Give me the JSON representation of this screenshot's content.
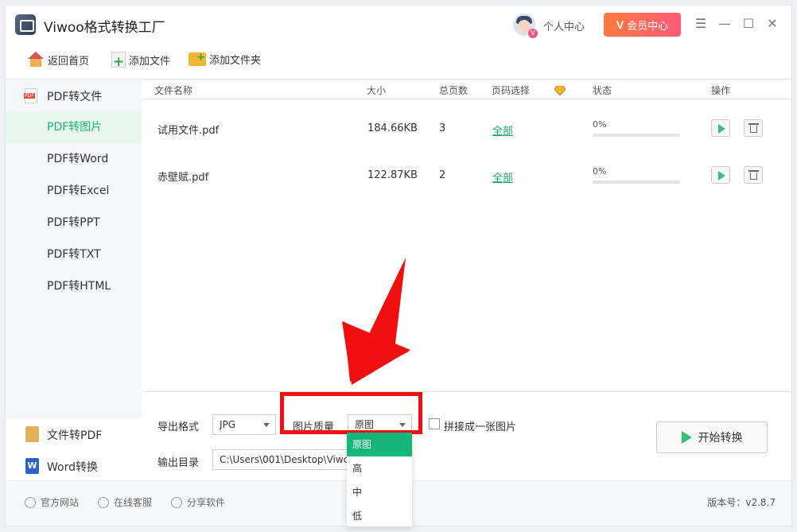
{
  "app": {
    "title": "Viwoo格式转换工厂"
  },
  "header": {
    "personal_center": "个人中心",
    "vip_center": "会员中心",
    "vip_badge": "V"
  },
  "toolbar": {
    "home": "返回首页",
    "add_file": "添加文件",
    "add_folder": "添加文件夹"
  },
  "sidebar": {
    "section_title": "PDF转文件",
    "items": [
      {
        "label": "PDF转图片",
        "active": true
      },
      {
        "label": "PDF转Word",
        "active": false
      },
      {
        "label": "PDF转Excel",
        "active": false
      },
      {
        "label": "PDF转PPT",
        "active": false
      },
      {
        "label": "PDF转TXT",
        "active": false
      },
      {
        "label": "PDF转HTML",
        "active": false
      }
    ],
    "bottom": [
      {
        "label": "文件转PDF",
        "icon": "file-to-pdf-icon"
      },
      {
        "label": "Word转换",
        "icon": "word-icon",
        "icon_letter": "W"
      }
    ]
  },
  "table": {
    "headers": {
      "name": "文件名称",
      "size": "大小",
      "pages": "总页数",
      "page_select": "页码选择",
      "status": "状态",
      "actions": "操作"
    },
    "rows": [
      {
        "name": "试用文件.pdf",
        "size": "184.66KB",
        "pages": "3",
        "page_select": "全部",
        "progress_label": "0%",
        "progress": 0
      },
      {
        "name": "赤壁赋.pdf",
        "size": "122.87KB",
        "pages": "2",
        "page_select": "全部",
        "progress_label": "0%",
        "progress": 0
      }
    ]
  },
  "options": {
    "export_format_label": "导出格式",
    "export_format_value": "JPG",
    "quality_label": "图片质量",
    "quality_value": "原图",
    "merge_label": "拼接成一张图片",
    "merge_checked": false,
    "output_dir_label": "输出目录",
    "output_dir_value": "C:\\Users\\001\\Desktop\\Viwc",
    "start_button": "开始转换"
  },
  "quality_dropdown": {
    "options": [
      "原图",
      "高",
      "中",
      "低"
    ],
    "selected": "原图"
  },
  "statusbar": {
    "website": "官方网站",
    "support": "在线客服",
    "share": "分享软件",
    "version": "版本号：v2.8.7"
  },
  "colors": {
    "accent": "#16b57a",
    "vip_start": "#ff7a3c",
    "vip_end": "#ff5a7a",
    "annotation": "#f01010"
  }
}
